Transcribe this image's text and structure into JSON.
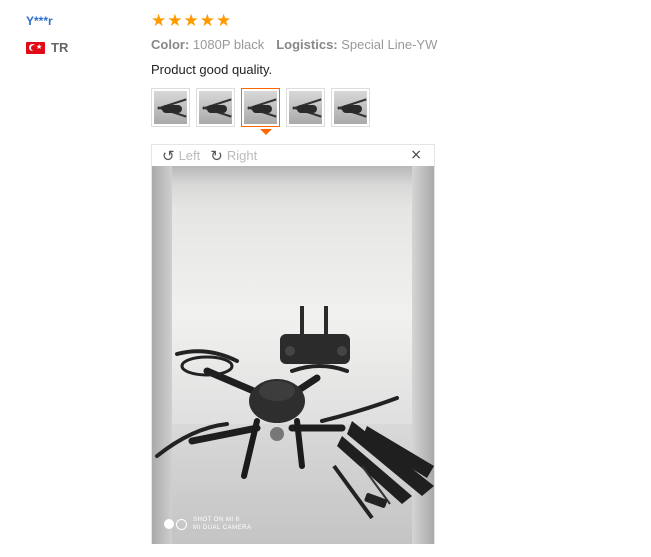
{
  "review": {
    "user_name": "Y***r",
    "country_code": "TR",
    "rating": 5,
    "stars": [
      "★",
      "★",
      "★",
      "★",
      "★"
    ],
    "color_label": "Color:",
    "color_value": "1080P black",
    "logistics_label": "Logistics:",
    "logistics_value": "Special Line-YW",
    "text": "Product good quality."
  },
  "thumbnails": [
    {
      "name": "review-photo-1",
      "active": false
    },
    {
      "name": "review-photo-2",
      "active": false
    },
    {
      "name": "review-photo-3",
      "active": true
    },
    {
      "name": "review-photo-4",
      "active": false
    },
    {
      "name": "review-photo-5",
      "active": false
    }
  ],
  "viewer": {
    "rotate_left_label": "Left",
    "rotate_right_label": "Right",
    "close_icon": "×",
    "watermark_line1": "SHOT ON MI 6",
    "watermark_line2": "MI DUAL CAMERA"
  },
  "colors": {
    "accent": "#ff6600",
    "star": "#ff9a00",
    "user_link": "#2e6fcb"
  }
}
